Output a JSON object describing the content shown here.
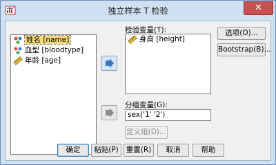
{
  "window": {
    "title": "独立样本 T 检验",
    "close_label": "✕"
  },
  "source_list": {
    "items": [
      {
        "label": "姓名 [name]",
        "icon": "nominal-variable-icon",
        "selected": true
      },
      {
        "label": "血型 [bloodtype]",
        "icon": "nominal-variable-icon",
        "selected": false
      },
      {
        "label": "年龄 [age]",
        "icon": "scale-variable-icon",
        "selected": false
      }
    ]
  },
  "test_variables": {
    "label": "检验变量(T):",
    "items": [
      {
        "label": "身高 [height]",
        "icon": "scale-variable-icon"
      }
    ]
  },
  "grouping_variable": {
    "label": "分组变量(G):",
    "value": "sex('1' '2')",
    "define_groups_label": "定义组(D)..."
  },
  "side_buttons": {
    "options_label": "选项(O)...",
    "bootstrap_label": "Bootstrap(B)..."
  },
  "bottom_buttons": {
    "ok_label": "确定",
    "paste_label": "粘贴(P)",
    "reset_label": "重置(R)",
    "cancel_label": "取消",
    "help_label": "帮助"
  },
  "colors": {
    "title_bar": "#cfe0f3",
    "close_button": "#c75050",
    "selection": "#f5d97a",
    "arrow_active": "#3b78c2"
  }
}
